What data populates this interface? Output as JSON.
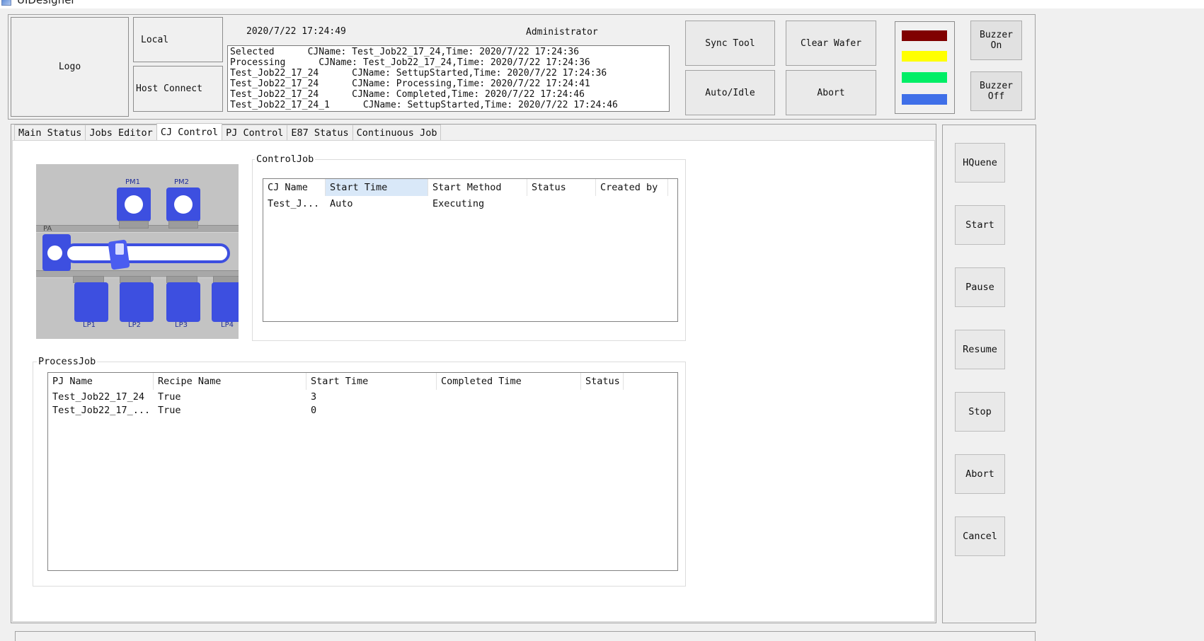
{
  "window": {
    "title": "UIDesigner"
  },
  "header": {
    "logo_label": "Logo",
    "mode_label": "Local",
    "host_connect_label": "Host Connect",
    "datetime": "2020/7/22 17:24:49",
    "user": "Administrator",
    "event_log": [
      "Selected      CJName: Test_Job22_17_24,Time: 2020/7/22 17:24:36",
      "Processing      CJName: Test_Job22_17_24,Time: 2020/7/22 17:24:36",
      "Test_Job22_17_24      CJName: SettupStarted,Time: 2020/7/22 17:24:36",
      "Test_Job22_17_24      CJName: Processing,Time: 2020/7/22 17:24:41",
      "Test_Job22_17_24      CJName: Completed,Time: 2020/7/22 17:24:46",
      "Test_Job22_17_24_1      CJName: SettupStarted,Time: 2020/7/22 17:24:46"
    ],
    "buttons": {
      "sync_tool": "Sync Tool",
      "clear_wafer": "Clear Wafer",
      "auto_idle": "Auto/Idle",
      "abort": "Abort",
      "buzzer_on": "Buzzer\nOn",
      "buzzer_off": "Buzzer\nOff"
    },
    "signal_colors": [
      "#800000",
      "#ffff00",
      "#00ee66",
      "#3f6fe8"
    ]
  },
  "tabs": [
    {
      "label": "Main Status"
    },
    {
      "label": "Jobs Editor"
    },
    {
      "label": "CJ Control"
    },
    {
      "label": "PJ Control"
    },
    {
      "label": "E87 Status"
    },
    {
      "label": "Continuous Job"
    }
  ],
  "active_tab": "CJ Control",
  "equipment_map": {
    "pm_labels": [
      "PM1",
      "PM2"
    ],
    "pa_label": "PA",
    "lp_labels": [
      "LP1",
      "LP2",
      "LP3",
      "LP4"
    ]
  },
  "control_job": {
    "group_title": "ControlJob",
    "columns": [
      "CJ Name",
      "Start Time",
      "Start Method",
      "Status",
      "Created by"
    ],
    "rows": [
      [
        "Test_J...",
        "Auto",
        "Executing",
        "",
        ""
      ]
    ]
  },
  "process_job": {
    "group_title": "ProcessJob",
    "columns": [
      "PJ Name",
      "Recipe Name",
      "Start Time",
      "Completed Time",
      "Status"
    ],
    "rows": [
      [
        "Test_Job22_17_24",
        "True",
        "3",
        "",
        ""
      ],
      [
        "Test_Job22_17_...",
        "True",
        "0",
        "",
        ""
      ]
    ]
  },
  "side_buttons": {
    "hqueue": "HQuene",
    "start": "Start",
    "pause": "Pause",
    "resume": "Resume",
    "stop": "Stop",
    "abort": "Abort",
    "cancel": "Cancel"
  }
}
